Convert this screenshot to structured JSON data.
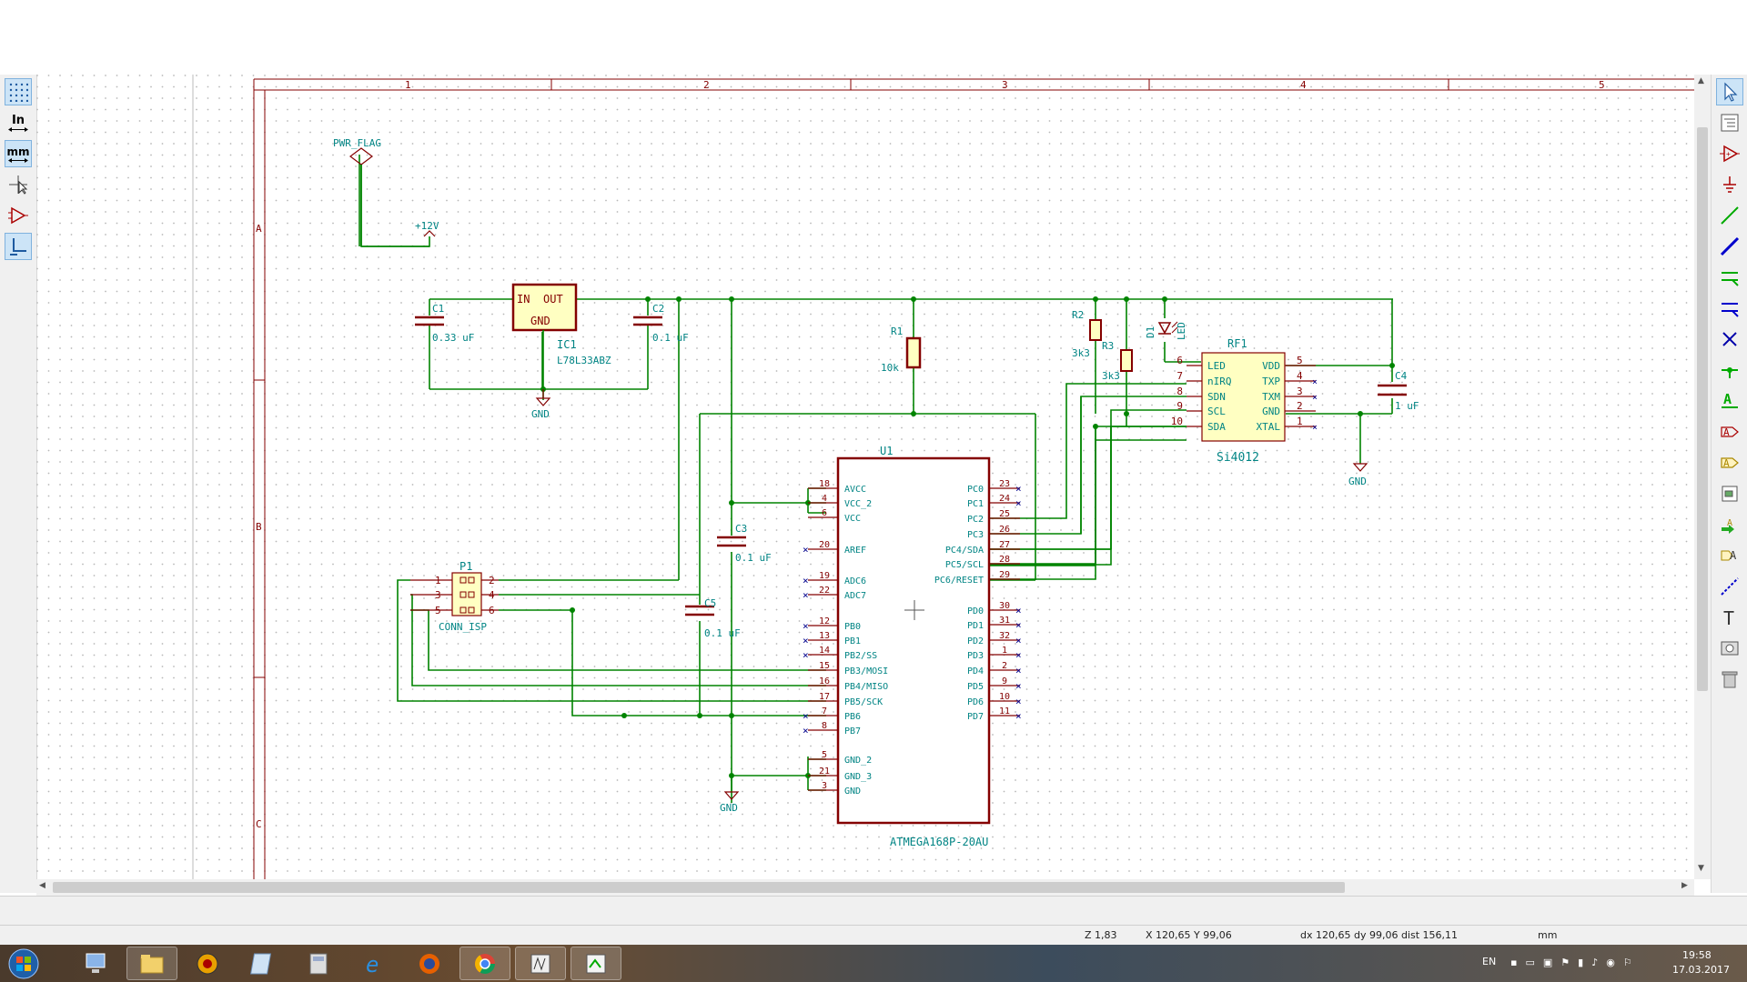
{
  "status": {
    "zoom": "Z 1,83",
    "abs_coords": "X 120,65  Y 99,06",
    "rel_coords": "dx 120,65  dy 99,06  dist 156,11",
    "units": "mm"
  },
  "left_toolbar": {
    "inch_label": "In",
    "mm_label": "mm"
  },
  "taskbar": {
    "lang": "EN",
    "time": "19:58",
    "date": "17.03.2017"
  },
  "sheet": {
    "col_labels": [
      "1",
      "2",
      "3",
      "4",
      "5"
    ],
    "row_labels": [
      "A",
      "B",
      "C"
    ]
  },
  "schematic": {
    "pwr_flag": "PWR_FLAG",
    "plus12v": "+12V",
    "c1": {
      "ref": "C1",
      "value": "0.33 uF"
    },
    "c2": {
      "ref": "C2",
      "value": "0.1 uF"
    },
    "c3": {
      "ref": "C3",
      "value": "0.1 uF"
    },
    "c4": {
      "ref": "C4",
      "value": "1 uF"
    },
    "c5": {
      "ref": "C5",
      "value": "0.1 uF"
    },
    "ic1": {
      "ref": "IC1",
      "value": "L78L33ABZ",
      "pin_in": "IN",
      "pin_out": "OUT",
      "pin_gnd": "GND"
    },
    "r1": {
      "ref": "R1",
      "value": "10k"
    },
    "r2": {
      "ref": "R2",
      "value": "3k3"
    },
    "r3": {
      "ref": "R3",
      "value": "3k3"
    },
    "d1": {
      "ref": "D1",
      "value": "LED"
    },
    "gnd": "GND",
    "p1": {
      "ref": "P1",
      "value": "CONN_ISP",
      "pins": [
        "1",
        "2",
        "3",
        "4",
        "5",
        "6"
      ]
    },
    "rf1": {
      "ref": "RF1",
      "value": "Si4012",
      "left_pins": [
        {
          "num": "6",
          "name": "LED"
        },
        {
          "num": "7",
          "name": "nIRQ"
        },
        {
          "num": "8",
          "name": "SDN"
        },
        {
          "num": "9",
          "name": "SCL"
        },
        {
          "num": "10",
          "name": "SDA"
        }
      ],
      "right_pins": [
        {
          "num": "5",
          "name": "VDD"
        },
        {
          "num": "4",
          "name": "TXP"
        },
        {
          "num": "3",
          "name": "TXM"
        },
        {
          "num": "2",
          "name": "GND"
        },
        {
          "num": "1",
          "name": "XTAL"
        }
      ]
    },
    "u1": {
      "ref": "U1",
      "value": "ATMEGA168P-20AU",
      "left_pins": [
        {
          "num": "18",
          "name": "AVCC"
        },
        {
          "num": "4",
          "name": "VCC_2"
        },
        {
          "num": "6",
          "name": "VCC"
        },
        {
          "num": "20",
          "name": "AREF"
        },
        {
          "num": "19",
          "name": "ADC6"
        },
        {
          "num": "22",
          "name": "ADC7"
        },
        {
          "num": "12",
          "name": "PB0"
        },
        {
          "num": "13",
          "name": "PB1"
        },
        {
          "num": "14",
          "name": "PB2/SS"
        },
        {
          "num": "15",
          "name": "PB3/MOSI"
        },
        {
          "num": "16",
          "name": "PB4/MISO"
        },
        {
          "num": "17",
          "name": "PB5/SCK"
        },
        {
          "num": "7",
          "name": "PB6"
        },
        {
          "num": "8",
          "name": "PB7"
        },
        {
          "num": "5",
          "name": "GND_2"
        },
        {
          "num": "21",
          "name": "GND_3"
        },
        {
          "num": "3",
          "name": "GND"
        }
      ],
      "right_pins": [
        {
          "num": "23",
          "name": "PC0"
        },
        {
          "num": "24",
          "name": "PC1"
        },
        {
          "num": "25",
          "name": "PC2"
        },
        {
          "num": "26",
          "name": "PC3"
        },
        {
          "num": "27",
          "name": "PC4/SDA"
        },
        {
          "num": "28",
          "name": "PC5/SCL"
        },
        {
          "num": "29",
          "name": "PC6/RESET"
        },
        {
          "num": "30",
          "name": "PD0"
        },
        {
          "num": "31",
          "name": "PD1"
        },
        {
          "num": "32",
          "name": "PD2"
        },
        {
          "num": "1",
          "name": "PD3"
        },
        {
          "num": "2",
          "name": "PD4"
        },
        {
          "num": "9",
          "name": "PD5"
        },
        {
          "num": "10",
          "name": "PD6"
        },
        {
          "num": "11",
          "name": "PD7"
        }
      ]
    }
  },
  "colors": {
    "wire": "#008400",
    "component": "#840000",
    "pin_text": "#008484",
    "label": "#008484",
    "grid_dot": "#b8b8b8"
  }
}
